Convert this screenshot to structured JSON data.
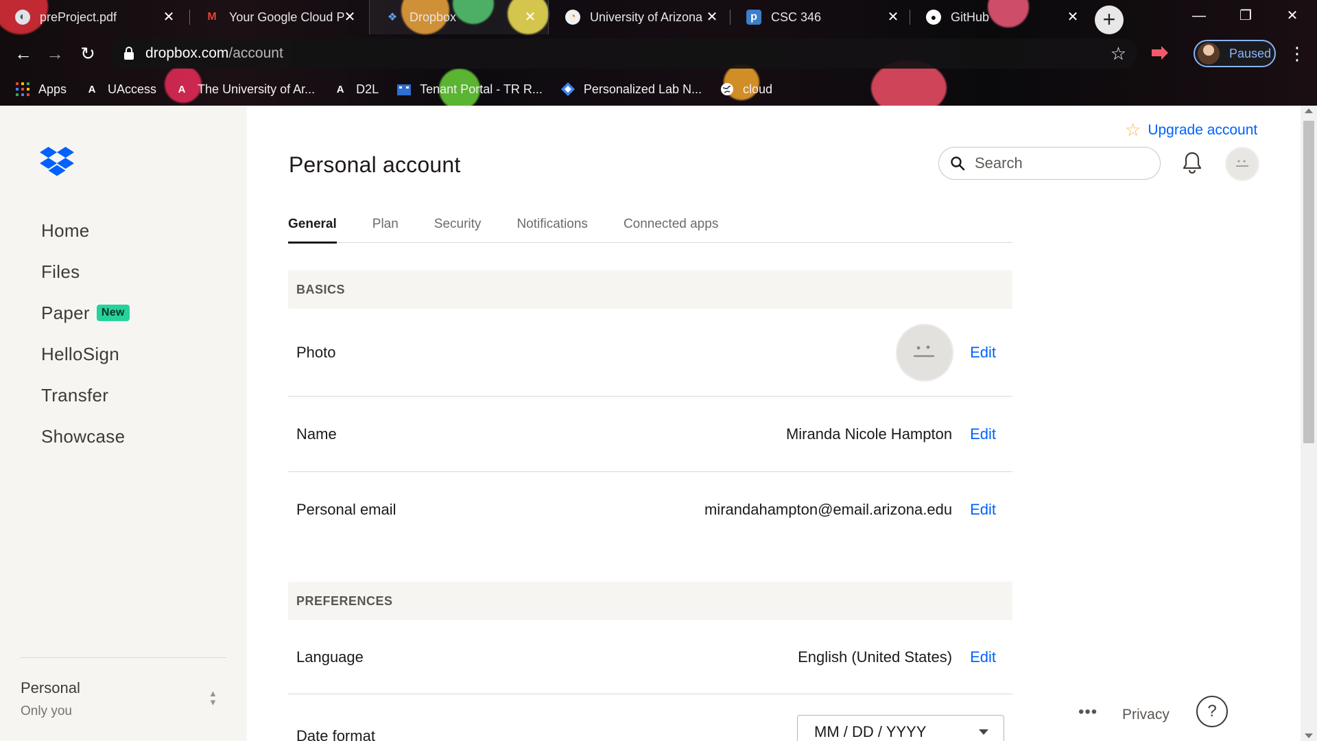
{
  "browser": {
    "tabs": [
      {
        "title": "preProject.pdf",
        "icon": "google-drive-icon",
        "active": false
      },
      {
        "title": "Your Google Cloud P",
        "icon": "gmail-icon",
        "active": false
      },
      {
        "title": "Dropbox",
        "icon": "dropbox-icon",
        "active": true
      },
      {
        "title": "University of Arizona",
        "icon": "globe-icon",
        "active": false
      },
      {
        "title": "CSC 346",
        "icon": "piazza-icon",
        "active": false
      },
      {
        "title": "GitHub",
        "icon": "github-icon",
        "active": false
      }
    ],
    "url_host": "dropbox.com",
    "url_path": "/account",
    "profile_status": "Paused",
    "bookmarks": [
      {
        "label": "Apps",
        "icon": "apps-grid-icon"
      },
      {
        "label": "UAccess",
        "icon": "arizona-a-icon"
      },
      {
        "label": "The University of Ar...",
        "icon": "arizona-a-icon"
      },
      {
        "label": "D2L",
        "icon": "arizona-a-icon"
      },
      {
        "label": "Tenant Portal - TR R...",
        "icon": "building-icon"
      },
      {
        "label": "Personalized Lab N...",
        "icon": "diamond-icon"
      },
      {
        "label": "cloud",
        "icon": "globe-icon"
      }
    ]
  },
  "sidebar": {
    "nav": [
      {
        "label": "Home"
      },
      {
        "label": "Files"
      },
      {
        "label": "Paper",
        "badge": "New"
      },
      {
        "label": "HelloSign"
      },
      {
        "label": "Transfer"
      },
      {
        "label": "Showcase"
      }
    ],
    "account_name": "Personal",
    "account_sub": "Only you"
  },
  "header": {
    "upgrade_label": "Upgrade account",
    "title": "Personal account",
    "search_placeholder": "Search"
  },
  "account_tabs": [
    {
      "label": "General",
      "active": true
    },
    {
      "label": "Plan",
      "active": false
    },
    {
      "label": "Security",
      "active": false
    },
    {
      "label": "Notifications",
      "active": false
    },
    {
      "label": "Connected apps",
      "active": false
    }
  ],
  "basics": {
    "heading": "BASICS",
    "photo_label": "Photo",
    "name_label": "Name",
    "name_value": "Miranda Nicole Hampton",
    "email_label": "Personal email",
    "email_value": "mirandahampton@email.arizona.edu",
    "edit_label": "Edit"
  },
  "preferences": {
    "heading": "PREFERENCES",
    "language_label": "Language",
    "language_value": "English (United States)",
    "date_format_label": "Date format",
    "date_format_value": "MM / DD / YYYY"
  },
  "footer": {
    "more": "•••",
    "privacy": "Privacy",
    "help": "?"
  },
  "colors": {
    "accent": "#0061fe",
    "badge_new": "#25d29c",
    "sidebar_bg": "#f7f5f2"
  }
}
